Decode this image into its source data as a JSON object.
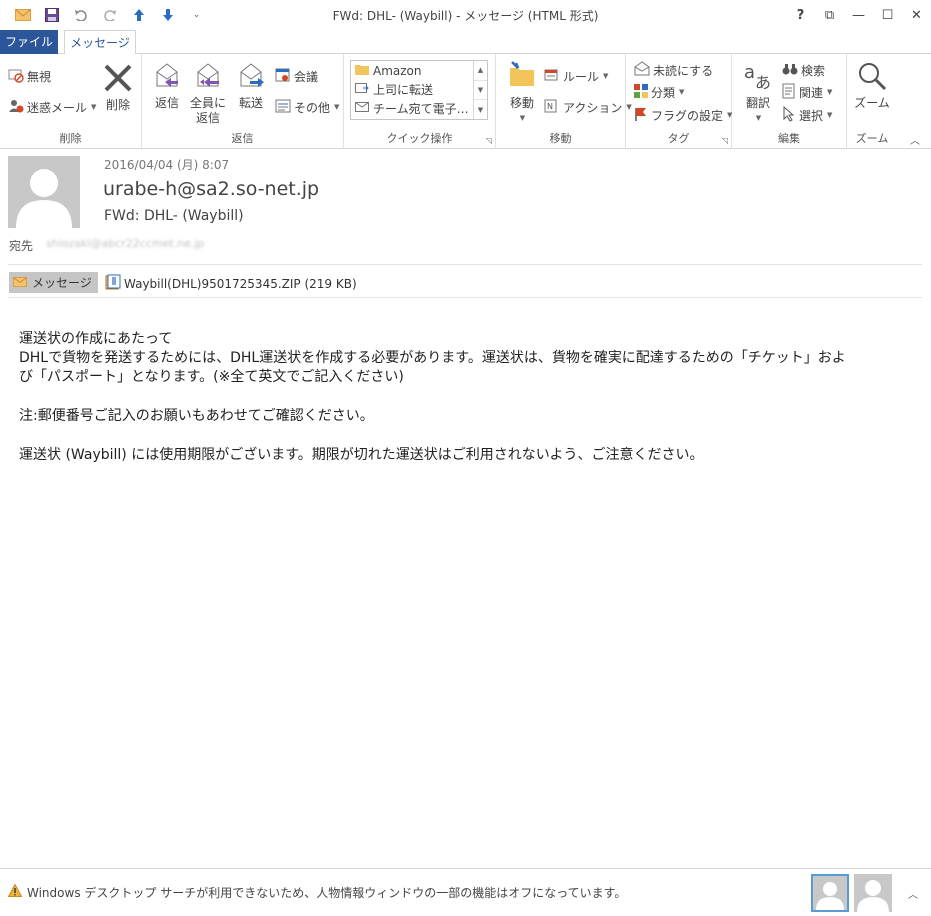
{
  "window": {
    "title": "FWd: DHL- (Waybill) - メッセージ (HTML 形式)",
    "controls": {
      "help": "?",
      "restore_ribbon": "⧉",
      "minimize": "—",
      "maximize": "☐",
      "close": "✕"
    }
  },
  "tabs": {
    "file": "ファイル",
    "message": "メッセージ"
  },
  "ribbon": {
    "delete_group": {
      "ignore": "無視",
      "junk": "迷惑メール",
      "delete": "削除",
      "label": "削除"
    },
    "respond_group": {
      "reply": "返信",
      "reply_all_1": "全員に",
      "reply_all_2": "返信",
      "forward": "転送",
      "meeting": "会議",
      "more": "その他",
      "label": "返信"
    },
    "quick_steps": {
      "items": [
        "Amazon",
        "上司に転送",
        "チーム宛て電子…"
      ],
      "label": "クイック操作"
    },
    "move_group": {
      "move": "移動",
      "rules": "ルール",
      "actions": "アクション",
      "label": "移動"
    },
    "tags_group": {
      "unread": "未読にする",
      "categorize": "分類",
      "follow_up": "フラグの設定",
      "label": "タグ"
    },
    "edit_group": {
      "translate": "翻訳",
      "find": "検索",
      "related": "関連",
      "select": "選択",
      "label": "編集"
    },
    "zoom_group": {
      "zoom": "ズーム",
      "label": "ズーム"
    }
  },
  "message": {
    "date": "2016/04/04 (月) 8:07",
    "sender": "urabe-h@sa2.so-net.jp",
    "subject": "FWd: DHL- (Waybill)",
    "to_label": "宛先",
    "to_value": "shiozaki@abcr22ccmet.ne.jp",
    "message_chip": "メッセージ",
    "attachment": "Waybill(DHL)9501725345.ZIP (219 KB)",
    "body": {
      "line1": "運送状の作成にあたって",
      "line2": "DHLで貨物を発送するためには、DHL運送状を作成する必要があります。運送状は、貨物を確実に配達するための「チケット」およ",
      "line3": "び「パスポート」となります。(※全て英文でご記入ください)",
      "line4": "注:郵便番号ご記入のお願いもあわせてご確認ください。",
      "line5": "運送状 (Waybill) には使用期限がございます。期限が切れた運送状はご利用されないよう、ご注意ください。"
    }
  },
  "status": {
    "text": "Windows デスクトップ サーチが利用できないため、人物情報ウィンドウの一部の機能はオフになっています。"
  },
  "colors": {
    "accent": "#2b579a",
    "ribbon_border": "#d4d4d4"
  }
}
